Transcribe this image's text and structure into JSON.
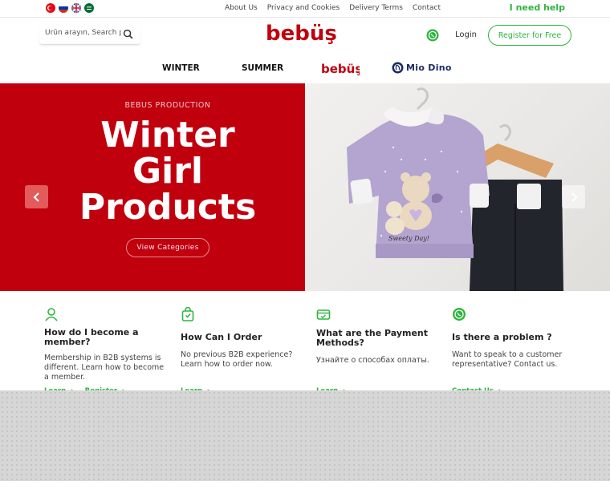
{
  "topbar": {
    "flags": [
      "turkey-flag",
      "russia-flag",
      "uk-flag",
      "saudi-flag"
    ],
    "links": [
      "About Us",
      "Privacy and Cookies",
      "Delivery Terms",
      "Contact"
    ],
    "help": "I need help"
  },
  "header": {
    "search_placeholder": "Ürün arayın, Search pr",
    "logo_text": "bebüş",
    "login": "Login",
    "register": "Register for Free"
  },
  "nav": {
    "items": [
      "WINTER",
      "SUMMER"
    ],
    "brand_logo": "bebüş",
    "second_brand": "Mio Dino"
  },
  "hero": {
    "subtitle": "BEBUS PRODUCTION",
    "title_line1": "Winter",
    "title_line2": "Girl",
    "title_line3": "Products",
    "button": "View Categories",
    "sweater_text": "Sweety Day!"
  },
  "info": [
    {
      "icon": "user-icon",
      "title": "How do I become a member?",
      "text": "Membership in B2B systems is different. Learn how to become a member.",
      "links": [
        "Learn",
        "Register"
      ]
    },
    {
      "icon": "shopping-bag-icon",
      "title": "How Can I Order",
      "text": "No previous B2B experience? Learn how to order now.",
      "links": [
        "Learn"
      ]
    },
    {
      "icon": "payment-card-icon",
      "title": "What are the Payment Methods?",
      "text": "Узнайте о способах оплаты.",
      "links": [
        "Learn"
      ]
    },
    {
      "icon": "whatsapp-icon",
      "title": "Is there a problem ?",
      "text": "Want to speak to a customer representative? Contact us.",
      "links": [
        "Contact Us"
      ]
    }
  ],
  "colors": {
    "brand_red": "#c1000e",
    "accent_green": "#2db53c"
  }
}
